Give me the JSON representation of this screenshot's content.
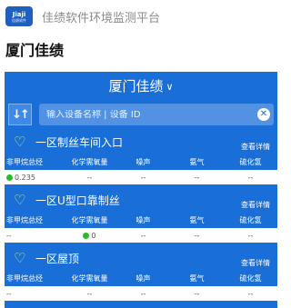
{
  "app": {
    "title": "佳绩软件环境监测平台",
    "logo_text": "Jiaji",
    "logo_sub": "佳绩软件"
  },
  "page": {
    "title": "厦门佳绩"
  },
  "phone": {
    "title": "厦门佳绩",
    "search": {
      "placeholder": "输入设备名称 | 设备 ID"
    },
    "columns": [
      "非甲烷总烃",
      "化学需氧量",
      "噪声",
      "氨气",
      "硫化氢"
    ],
    "detail_label": "查看详情",
    "areas": [
      {
        "name": "一区制丝车间入口",
        "values": [
          "0.235",
          "--",
          "--",
          "--",
          "--"
        ],
        "status_col": 0
      },
      {
        "name": "一区U型口靠制丝",
        "values": [
          "--",
          "0",
          "--",
          "--",
          "--"
        ],
        "status_col": 1
      },
      {
        "name": "一区屋顶",
        "values": [
          "--",
          "--",
          "--",
          "--",
          "--"
        ],
        "status_col": -1
      }
    ]
  },
  "colors": {
    "brand": "#1a6ed8",
    "status_ok": "#22c022",
    "heart": "#b6ec7a"
  }
}
